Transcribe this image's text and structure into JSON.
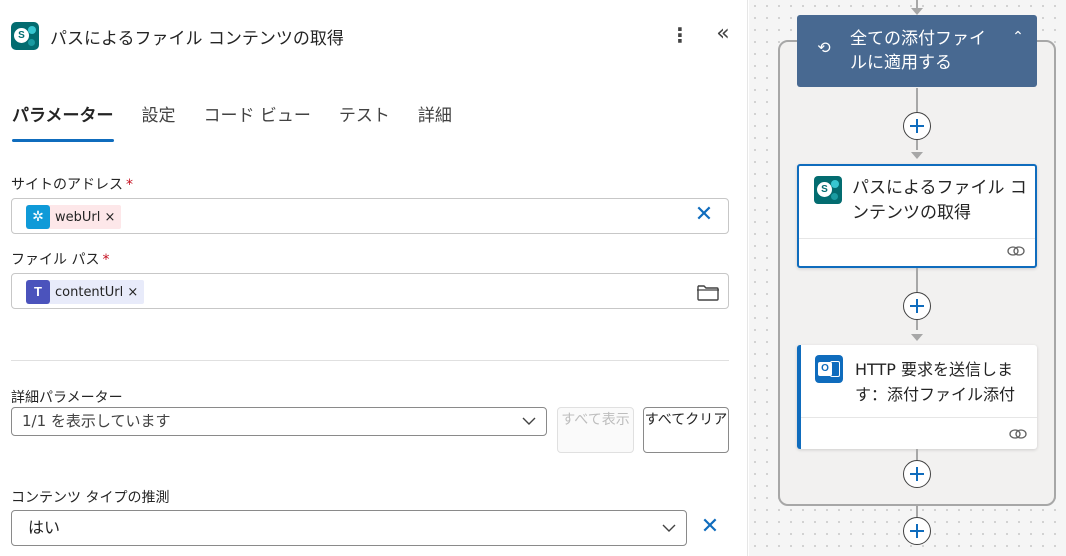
{
  "panel": {
    "title": "パスによるファイル コンテンツの取得",
    "tabs": [
      "パラメーター",
      "設定",
      "コード ビュー",
      "テスト",
      "詳細"
    ],
    "site_address": {
      "label": "サイトのアドレス",
      "required": "*",
      "token": "webUrl ×"
    },
    "file_path": {
      "label": "ファイル パス",
      "required": "*",
      "token": "contentUrl ×"
    },
    "advanced": {
      "label": "詳細パラメーター",
      "select_value": "1/1 を表示しています",
      "show_all": "すべて表示",
      "clear_all": "すべてクリア"
    },
    "content_type": {
      "label": "コンテンツ タイプの推測",
      "value": "はい"
    }
  },
  "canvas": {
    "foreach_title": "全ての添付ファイルに適用する",
    "card1_title": "パスによるファイル コンテンツの取得",
    "card2_title": "HTTP 要求を送信します：添付ファイル添付"
  },
  "colors": {
    "accent": "#0f6cbd",
    "sharepoint": "#036c70",
    "foreach": "#486991",
    "required": "#c50f1f"
  }
}
